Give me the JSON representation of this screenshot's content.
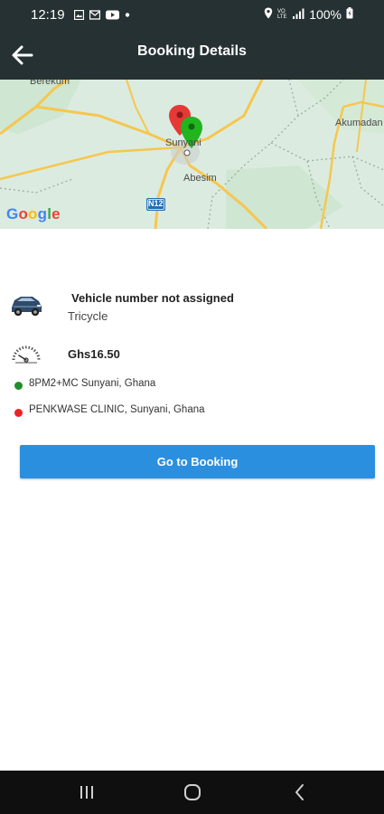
{
  "status_bar": {
    "time": "12:19",
    "battery": "100%",
    "icons": [
      "gallery-icon",
      "mail-icon",
      "youtube-icon",
      "dot-icon",
      "location-icon",
      "wifi-calling-icon",
      "signal-icon",
      "battery-icon"
    ]
  },
  "app_bar": {
    "title": "Booking Details",
    "back_icon": "arrow-left-icon"
  },
  "map": {
    "labels": {
      "berekum": "Berekum",
      "sunyani": "Sunyani",
      "abesim": "Abesim",
      "akumadan": "Akumadan",
      "n12": "N12"
    },
    "attribution": [
      "G",
      "o",
      "o",
      "g",
      "l",
      "e"
    ],
    "colors": {
      "land": "#dcebe0",
      "road": "#f5c74f",
      "water": "#aad3df",
      "pickup_pin": "#22b51f",
      "drop_pin": "#e53935"
    }
  },
  "booking": {
    "vehicle_number": "Vehicle number not assigned",
    "vehicle_type": "Tricycle",
    "fare": "Ghs16.50",
    "pickup": "8PM2+MC Sunyani, Ghana",
    "dropoff": "PENKWASE CLINIC, Sunyani, Ghana",
    "pickup_color": "#1f8f2a",
    "dropoff_color": "#ee2222"
  },
  "actions": {
    "go_to_booking": "Go to Booking",
    "button_color": "#2b8fe0"
  },
  "nav_bar": {
    "icons": [
      "recent-apps-icon",
      "home-icon",
      "back-nav-icon"
    ]
  }
}
